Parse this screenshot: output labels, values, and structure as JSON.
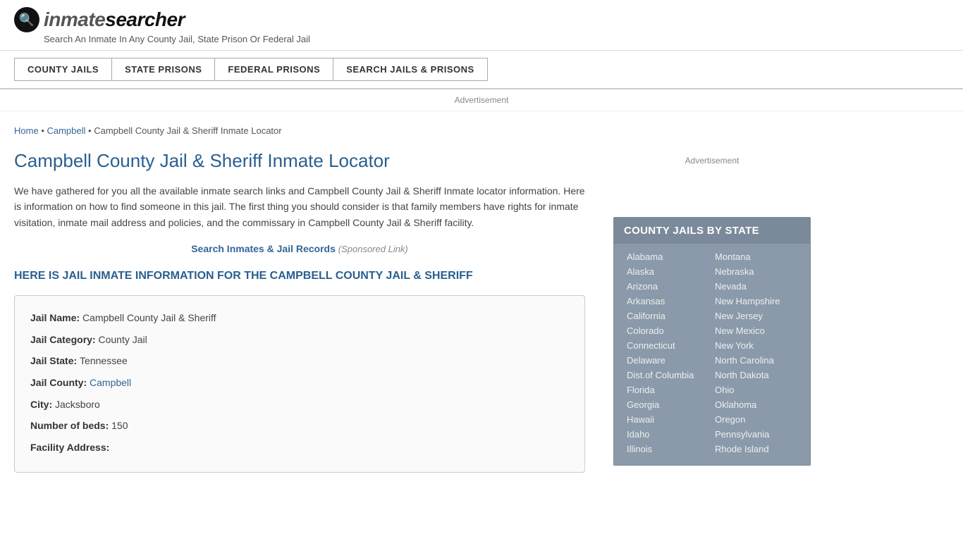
{
  "header": {
    "logo_symbol": "🔍",
    "logo_text_part1": "inmate",
    "logo_text_part2": "searcher",
    "tagline": "Search An Inmate In Any County Jail, State Prison Or Federal Jail"
  },
  "nav": {
    "items": [
      {
        "id": "county-jails",
        "label": "COUNTY JAILS"
      },
      {
        "id": "state-prisons",
        "label": "STATE PRISONS"
      },
      {
        "id": "federal-prisons",
        "label": "FEDERAL PRISONS"
      },
      {
        "id": "search-jails",
        "label": "SEARCH JAILS & PRISONS"
      }
    ]
  },
  "ad": {
    "label": "Advertisement"
  },
  "breadcrumb": {
    "home": "Home",
    "separator1": "•",
    "link2": "Campbell",
    "separator2": "•",
    "current": "Campbell County Jail & Sheriff Inmate Locator"
  },
  "page": {
    "title": "Campbell County Jail & Sheriff Inmate Locator",
    "description": "We have gathered for you all the available inmate search links and Campbell County Jail & Sheriff Inmate locator information. Here is information on how to find someone in this jail. The first thing you should consider is that family members have rights for inmate visitation, inmate mail address and policies, and the commissary in Campbell County Jail & Sheriff facility.",
    "search_link_text": "Search Inmates & Jail Records",
    "search_link_suffix": "(Sponsored Link)",
    "info_heading": "HERE IS JAIL INMATE INFORMATION FOR THE CAMPBELL COUNTY JAIL & SHERIFF"
  },
  "jail_info": {
    "fields": [
      {
        "label": "Jail Name:",
        "value": "Campbell County Jail & Sheriff",
        "link": false
      },
      {
        "label": "Jail Category:",
        "value": "County Jail",
        "link": false
      },
      {
        "label": "Jail State:",
        "value": "Tennessee",
        "link": false
      },
      {
        "label": "Jail County:",
        "value": "Campbell",
        "link": true
      },
      {
        "label": "City:",
        "value": "Jacksboro",
        "link": false
      },
      {
        "label": "Number of beds:",
        "value": "150",
        "link": false
      },
      {
        "label": "Facility Address:",
        "value": "",
        "link": false
      }
    ]
  },
  "sidebar": {
    "ad_label": "Advertisement",
    "state_box_header": "COUNTY JAILS BY STATE",
    "states_col1": [
      "Alabama",
      "Alaska",
      "Arizona",
      "Arkansas",
      "California",
      "Colorado",
      "Connecticut",
      "Delaware",
      "Dist.of Columbia",
      "Florida",
      "Georgia",
      "Hawaii",
      "Idaho",
      "Illinois"
    ],
    "states_col2": [
      "Montana",
      "Nebraska",
      "Nevada",
      "New Hampshire",
      "New Jersey",
      "New Mexico",
      "New York",
      "North Carolina",
      "North Dakota",
      "Ohio",
      "Oklahoma",
      "Oregon",
      "Pennsylvania",
      "Rhode Island"
    ]
  }
}
